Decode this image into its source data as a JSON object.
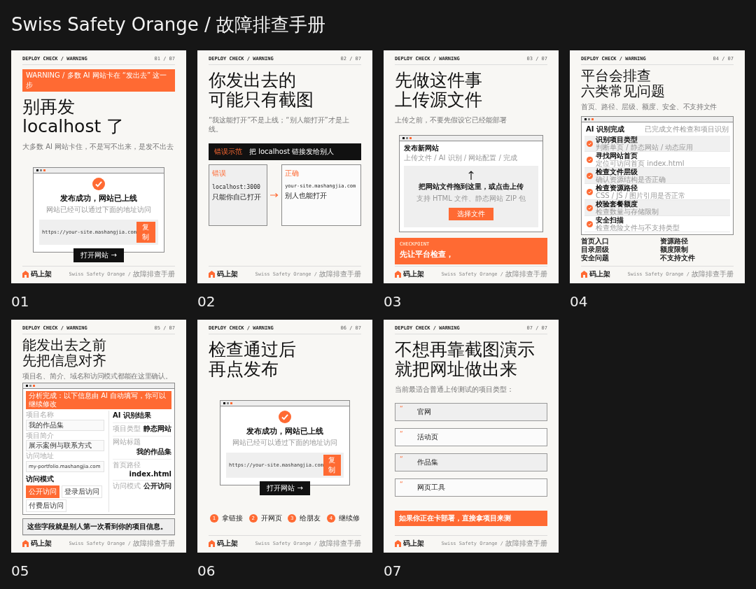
{
  "title": "Swiss Safety Orange / 故障排查手册",
  "slides": [
    {
      "kind": "success",
      "number": "01",
      "kicker": "DEPLOY CHECK / WARNING",
      "page": "01 / 07",
      "banner": "WARNING / 多数 AI 网站卡在 “发出去” 这一步",
      "headline": [
        "别再发",
        "localhost 了"
      ],
      "subtitle": "大多数 AI 网站卡住，不是写不出来，是发不出去",
      "window": {
        "title": "发布成功，网站已上线",
        "note": "网站已经可以通过下面的地址访问",
        "url": "https://your-site.mashangjia.com",
        "copy": "复制",
        "open": "打开网站 →"
      },
      "footer": {
        "brand": "码上架",
        "theme": "Swiss Safety Orange /",
        "manual": "故障排查手册"
      }
    },
    {
      "kind": "compare",
      "number": "02",
      "kicker": "DEPLOY CHECK / WARNING",
      "page": "02 / 07",
      "headline": [
        "你发出去的",
        "可能只有截图"
      ],
      "subtitle": "“我这能打开”不是上线；“别人能打开”才是上线。",
      "example": {
        "tag": "错误示范",
        "text": "把 localhost 链接发给别人"
      },
      "cards": [
        {
          "kind": "wrong",
          "tag": "错误",
          "code": "localhost:3000",
          "text": "只能你自己打开"
        },
        {
          "kind": "right",
          "tag": "正确",
          "code": "your-site.mashangjia.com",
          "text": "别人也能打开"
        }
      ],
      "footer": {
        "brand": "码上架",
        "theme": "Swiss Safety Orange /",
        "manual": "故障排查手册"
      }
    },
    {
      "kind": "upload",
      "number": "03",
      "kicker": "DEPLOY CHECK / WARNING",
      "page": "03 / 07",
      "headline": [
        "先做这件事",
        "上传源文件"
      ],
      "subtitle": "上传之前，不要先假设它已经能部署",
      "window": {
        "title": "发布新网站",
        "breadcrumb": "上传文件 / AI 识别 / 网站配置 / 完成",
        "drop": "把网站文件拖到这里，或点击上传",
        "hint": "支持 HTML 文件、静态网站 ZIP 包",
        "button": "选择文件"
      },
      "checkpoint": {
        "label": "CHECKPOINT",
        "text": "先让平台检查，"
      },
      "footer": {
        "brand": "码上架",
        "theme": "Swiss Safety Orange /",
        "manual": "故障排查手册"
      }
    },
    {
      "kind": "checks",
      "number": "04",
      "kicker": "DEPLOY CHECK / WARNING",
      "page": "04 / 07",
      "headline": [
        "平台会排查",
        "六类常见问题"
      ],
      "subtitle": "首页、路径、层级、额度、安全、不支持文件",
      "window": {
        "title": "AI 识别完成",
        "status": "已完成文件检查和项目识别"
      },
      "checks": [
        {
          "title": "识别项目类型",
          "detail": "判断单页 / 静态网站 / 动态应用",
          "done": true
        },
        {
          "title": "寻找网站首页",
          "detail": "定位可访问首页 index.html",
          "done": true
        },
        {
          "title": "检查文件层级",
          "detail": "确认资源结构是否正确",
          "done": true
        },
        {
          "title": "检查资源路径",
          "detail": "CSS / JS / 图片引用是否正常",
          "done": true
        },
        {
          "title": "校验套餐额度",
          "detail": "检查数量与存储限制",
          "done": true
        },
        {
          "title": "安全扫描",
          "detail": "检查危险文件与不支持类型",
          "done": true
        }
      ],
      "categories": [
        "首页入口",
        "资源路径",
        "目录层级",
        "额度限制",
        "安全问题",
        "不支持文件"
      ],
      "footer": {
        "brand": "码上架",
        "theme": "Swiss Safety Orange /",
        "manual": "故障排查手册"
      }
    },
    {
      "kind": "form",
      "number": "05",
      "kicker": "DEPLOY CHECK / WARNING",
      "page": "05 / 07",
      "headline": [
        "能发出去之前",
        "先把信息对齐"
      ],
      "subtitle": "项目名、简介、域名和访问模式都能在这里确认。",
      "banner": "分析完成：以下信息由 AI 自动填写，你可以继续修改",
      "fields": [
        {
          "label": "项目名称",
          "value": "我的作品集"
        },
        {
          "label": "项目简介",
          "value": "展示案例与联系方式"
        },
        {
          "label": "访问地址",
          "value": "my-portfolio.mashangjia.com"
        }
      ],
      "mode_label": "访问模式",
      "modes": [
        {
          "label": "公开访问",
          "selected": true
        },
        {
          "label": "登录后访问",
          "selected": false
        },
        {
          "label": "付费后访问",
          "selected": false
        }
      ],
      "results_title": "AI 识别结果",
      "results": [
        {
          "label": "项目类型",
          "value": "静态网站"
        },
        {
          "label": "网站标题",
          "value": "我的作品集"
        },
        {
          "label": "首页路径",
          "value": "index.html"
        },
        {
          "label": "访问模式",
          "value": "公开访问"
        }
      ],
      "note": "这些字段就是别人第一次看到你的项目信息。",
      "footer": {
        "brand": "码上架",
        "theme": "Swiss Safety Orange /",
        "manual": "故障排查手册"
      }
    },
    {
      "kind": "publish",
      "number": "06",
      "kicker": "DEPLOY CHECK / WARNING",
      "page": "06 / 07",
      "headline": [
        "检查通过后",
        "再点发布"
      ],
      "window": {
        "title": "发布成功，网站已上线",
        "note": "网站已经可以通过下面的地址访问",
        "url": "https://your-site.mashangjia.com",
        "copy": "复制",
        "open": "打开网站 →"
      },
      "steps": [
        {
          "number": "1",
          "label": "拿链接"
        },
        {
          "number": "2",
          "label": "开网页"
        },
        {
          "number": "3",
          "label": "给朋友"
        },
        {
          "number": "4",
          "label": "继续修"
        }
      ],
      "footer": {
        "brand": "码上架",
        "theme": "Swiss Safety Orange /",
        "manual": "故障排查手册"
      }
    },
    {
      "kind": "types",
      "number": "07",
      "kicker": "DEPLOY CHECK / WARNING",
      "page": "07 / 07",
      "headline": [
        "不想再靠截图演示",
        "就把网址做出来"
      ],
      "subtitle": "当前最适合普通上传测试的项目类型：",
      "types": [
        {
          "mark": "“",
          "label": "官网"
        },
        {
          "mark": "“",
          "label": "活动页"
        },
        {
          "mark": "“",
          "label": "作品集"
        },
        {
          "mark": "“",
          "label": "网页工具"
        }
      ],
      "callout": "如果你正在卡部署，直接拿项目来测",
      "footer": {
        "brand": "码上架",
        "theme": "Swiss Safety Orange /",
        "manual": "故障排查手册"
      }
    }
  ]
}
